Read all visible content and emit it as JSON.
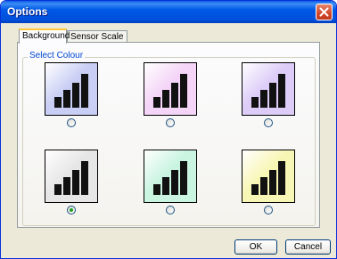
{
  "window": {
    "title": "Options",
    "close_icon": "close-icon"
  },
  "tabs": [
    {
      "label": "Background",
      "active": true
    },
    {
      "label": "Sensor Scale",
      "active": false
    }
  ],
  "group": {
    "label": "Select Colour"
  },
  "swatches": [
    {
      "color": "#c8cef4",
      "icon": "signal-bars-icon",
      "selected": false
    },
    {
      "color": "#f4d4f7",
      "icon": "signal-bars-icon",
      "selected": false
    },
    {
      "color": "#dcccf7",
      "icon": "signal-bars-icon",
      "selected": false
    },
    {
      "color": "#e6e6e6",
      "icon": "signal-bars-icon",
      "selected": true
    },
    {
      "color": "#c8f4e0",
      "icon": "signal-bars-icon",
      "selected": false
    },
    {
      "color": "#f8f6b4",
      "icon": "signal-bars-icon",
      "selected": false
    }
  ],
  "buttons": {
    "ok": "OK",
    "cancel": "Cancel"
  },
  "colors": {
    "title_bar": "#0054e3",
    "accent_tab": "#ffc83c",
    "group_label": "#0046d5",
    "radio_dot": "#21a121"
  }
}
